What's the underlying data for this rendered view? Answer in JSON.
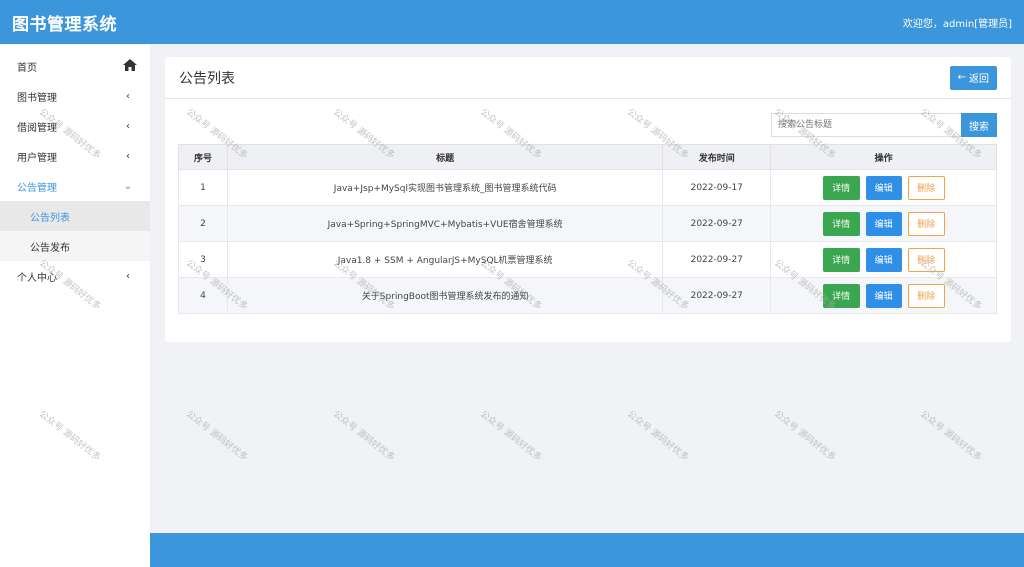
{
  "header": {
    "brand": "图书管理系统",
    "welcome": "欢迎您，admin[管理员]"
  },
  "sidebar": {
    "items": [
      {
        "label": "首页",
        "icon": "home-icon"
      },
      {
        "label": "图书管理",
        "icon": "chevron-left-icon"
      },
      {
        "label": "借阅管理",
        "icon": "chevron-left-icon"
      },
      {
        "label": "用户管理",
        "icon": "chevron-left-icon"
      },
      {
        "label": "公告管理",
        "icon": "chevron-down-icon",
        "active": true
      },
      {
        "label": "个人中心",
        "icon": "chevron-left-icon"
      }
    ],
    "sub_items": [
      {
        "label": "公告列表",
        "selected": true
      },
      {
        "label": "公告发布"
      }
    ]
  },
  "panel": {
    "title": "公告列表",
    "back_label": "返回",
    "search_placeholder": "搜索公告标题",
    "search_button": "搜索"
  },
  "table": {
    "headers": [
      "序号",
      "标题",
      "发布时间",
      "操作"
    ],
    "rows": [
      {
        "idx": "1",
        "title": "Java+Jsp+MySql实现图书管理系统_图书管理系统代码",
        "date": "2022-09-17"
      },
      {
        "idx": "2",
        "title": "Java+Spring+SpringMVC+Mybatis+VUE宿舍管理系统",
        "date": "2022-09-27"
      },
      {
        "idx": "3",
        "title": "Java1.8 + SSM + AngularJS+MySQL机票管理系统",
        "date": "2022-09-27"
      },
      {
        "idx": "4",
        "title": "关于SpringBoot图书管理系统发布的通知",
        "date": "2022-09-27"
      }
    ],
    "actions": {
      "detail": "详情",
      "edit": "编辑",
      "delete": "删除"
    }
  },
  "watermark": "公众号 源码好优多",
  "colors": {
    "primary": "#3c96dc",
    "detail": "#3aa64f",
    "edit": "#2f8fe6",
    "delete": "#f0a24e"
  }
}
